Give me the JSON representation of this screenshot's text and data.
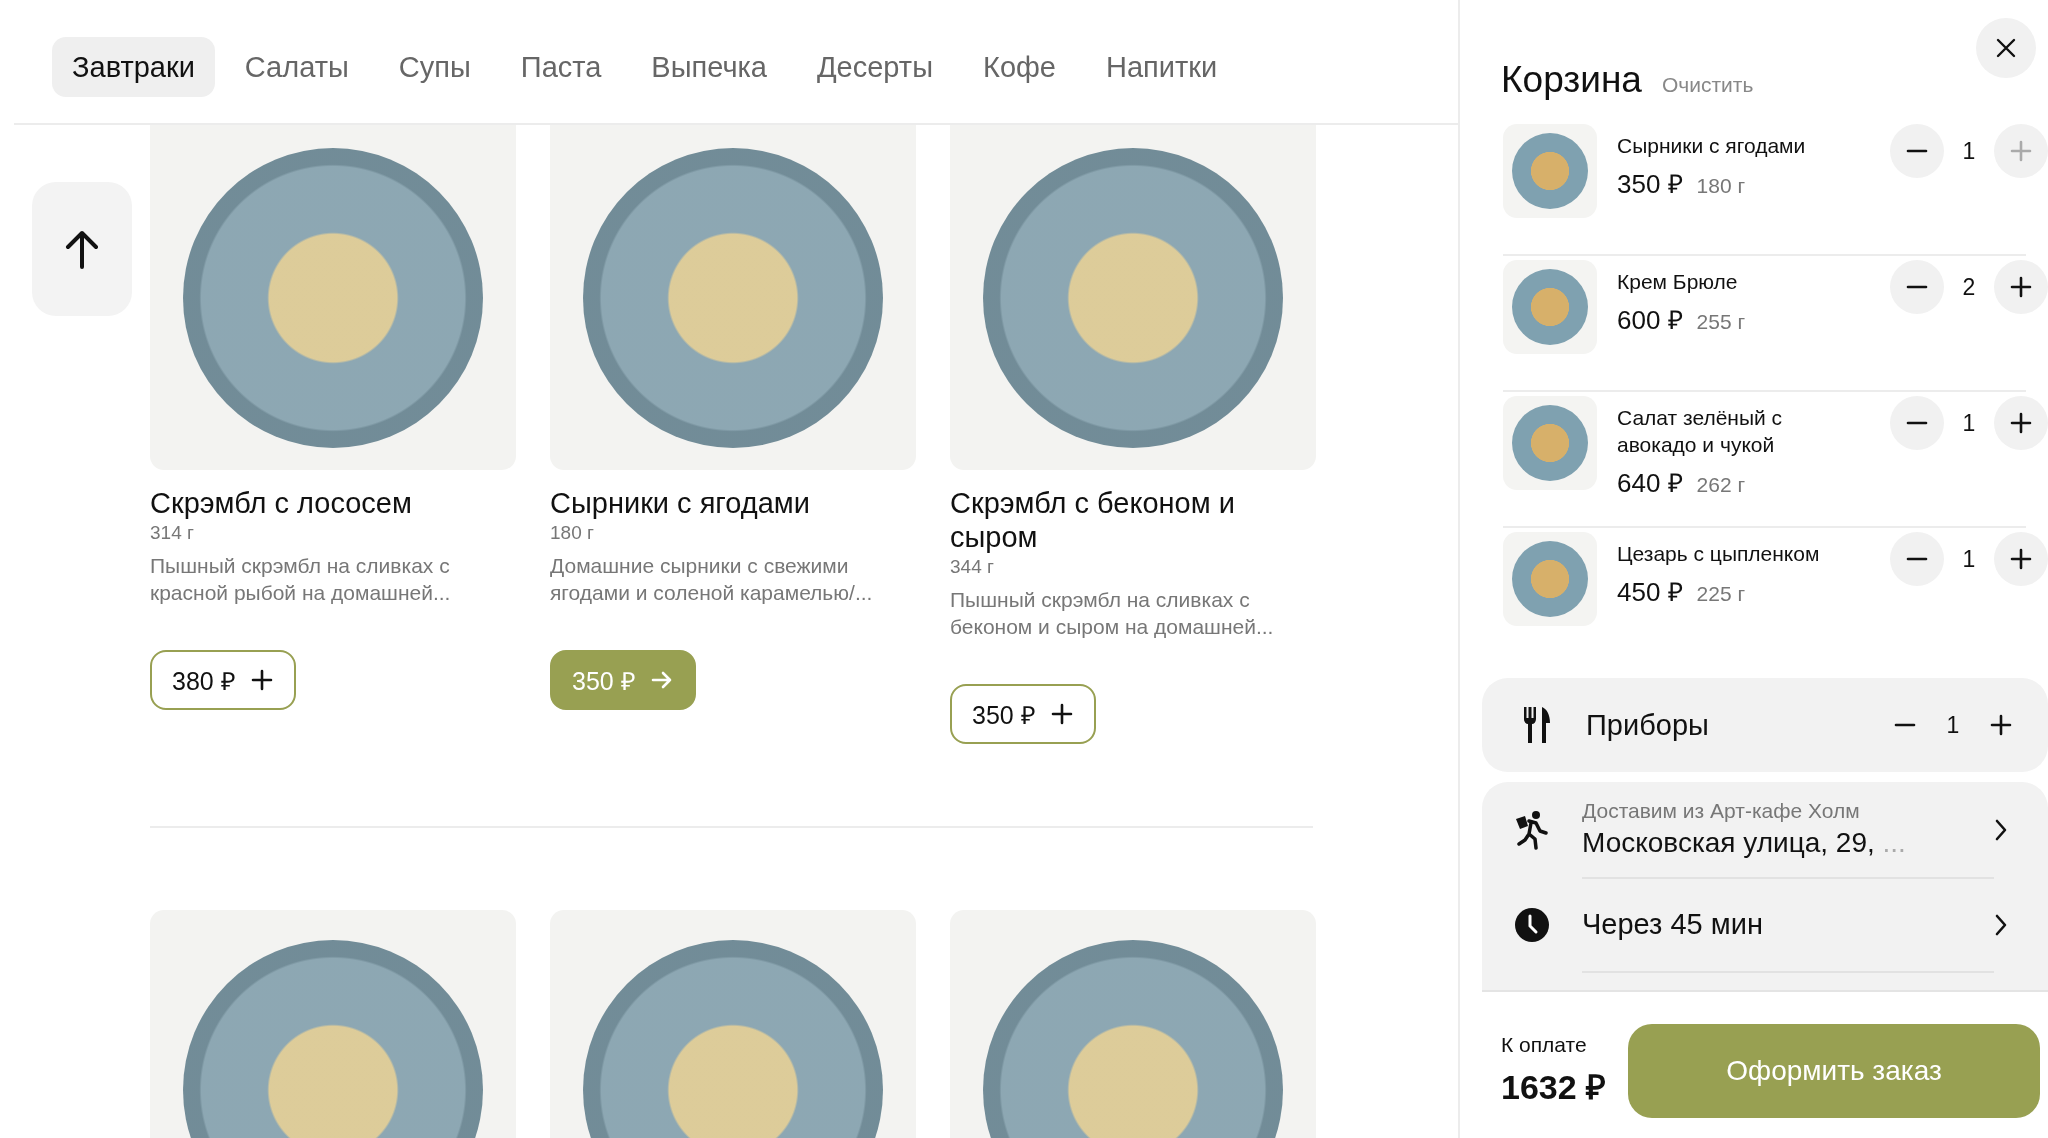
{
  "tabs": [
    {
      "label": "Завтраки",
      "selected": true
    },
    {
      "label": "Салаты",
      "selected": false
    },
    {
      "label": "Супы",
      "selected": false
    },
    {
      "label": "Паста",
      "selected": false
    },
    {
      "label": "Выпечка",
      "selected": false
    },
    {
      "label": "Десерты",
      "selected": false
    },
    {
      "label": "Кофе",
      "selected": false
    },
    {
      "label": "Напитки",
      "selected": false
    }
  ],
  "products": [
    {
      "name": "Скрэмбл с лососем",
      "weight": "314 г",
      "description": "Пышный скрэмбл на сливках с красной рыбой на домашней...",
      "price": "380 ₽",
      "in_cart": false
    },
    {
      "name": "Сырники с ягодами",
      "weight": "180 г",
      "description": "Домашние сырники с свежими ягодами и соленой карамелью/...",
      "price": "350 ₽",
      "in_cart": true
    },
    {
      "name": "Скрэмбл с беконом и сыром",
      "weight": "344 г",
      "description": "Пышный скрэмбл на сливках с беконом и сыром на домашней...",
      "price": "350 ₽",
      "in_cart": false
    }
  ],
  "cart": {
    "title": "Корзина",
    "clear": "Очистить",
    "items": [
      {
        "name": "Сырники с ягодами",
        "price": "350 ₽",
        "weight": "180 г",
        "quantity": "1",
        "plus_disabled": true
      },
      {
        "name": "Крем Брюле",
        "price": "600 ₽",
        "weight": "255 г",
        "quantity": "2",
        "plus_disabled": false
      },
      {
        "name": "Салат зелёный с авокадо и чукой",
        "price": "640 ₽",
        "weight": "262 г",
        "quantity": "1",
        "plus_disabled": false
      },
      {
        "name": "Цезарь с цыпленком",
        "price": "450 ₽",
        "weight": "225 г",
        "quantity": "1",
        "plus_disabled": false
      }
    ],
    "cutlery": {
      "label": "Приборы",
      "quantity": "1"
    },
    "delivery": {
      "caption": "Доставим из Арт-кафе Холм",
      "address": "Московская улица, 29,",
      "ellipsis": "..."
    },
    "time": {
      "label": "Через 45 мин"
    },
    "total_label": "К оплате",
    "total": "1632 ₽",
    "checkout": "Оформить заказ"
  }
}
